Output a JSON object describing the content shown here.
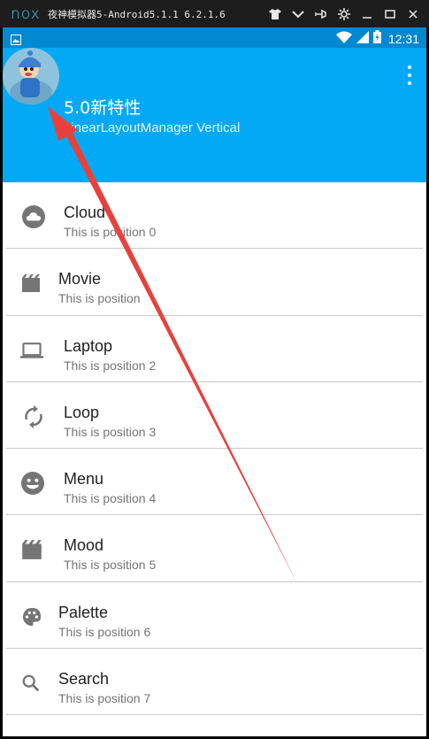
{
  "emulator": {
    "logo": "nox",
    "title": "夜神模拟器5-Android5.1.1 6.2.1.6",
    "icons": [
      "shirt-icon",
      "chevron-down-icon",
      "pin-icon",
      "gear-icon",
      "minimize-icon",
      "maximize-icon",
      "close-icon"
    ]
  },
  "statusbar": {
    "time": "12:31",
    "icons": [
      "image-icon",
      "wifi-icon",
      "signal-icon",
      "battery-icon"
    ]
  },
  "toolbar": {
    "title": "5.0新特性",
    "subtitle": "LinearLayoutManager Vertical",
    "background_color": "#03a9f4",
    "status_color": "#0288d1"
  },
  "list": {
    "items": [
      {
        "icon": "cloud-icon",
        "title": "Cloud",
        "subtitle": "This is position 0"
      },
      {
        "icon": "movie-icon",
        "title": "Movie",
        "subtitle": "This is position"
      },
      {
        "icon": "laptop-icon",
        "title": "Laptop",
        "subtitle": "This is position 2"
      },
      {
        "icon": "loop-icon",
        "title": "Loop",
        "subtitle": "This is position 3"
      },
      {
        "icon": "emoji-icon",
        "title": "Menu",
        "subtitle": "This is position 4"
      },
      {
        "icon": "movie-icon",
        "title": "Mood",
        "subtitle": "This is position 5"
      },
      {
        "icon": "palette-icon",
        "title": "Palette",
        "subtitle": "This is position 6"
      },
      {
        "icon": "search-icon",
        "title": "Search",
        "subtitle": "This is position 7"
      }
    ]
  },
  "annotation": {
    "color": "#e8413c"
  }
}
